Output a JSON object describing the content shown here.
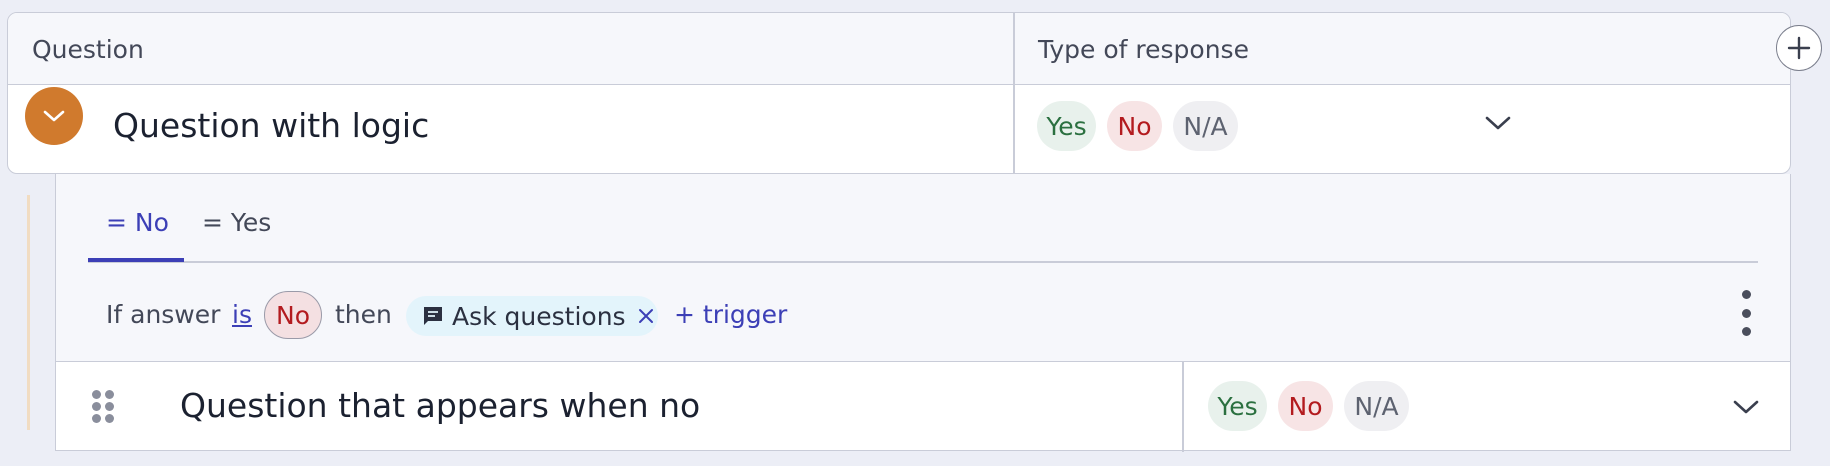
{
  "table": {
    "headers": {
      "question": "Question",
      "response": "Type of response"
    }
  },
  "main_question": {
    "title": "Question with logic",
    "responses": {
      "yes": "Yes",
      "no": "No",
      "na": "N/A"
    }
  },
  "logic": {
    "tabs": [
      {
        "label": "= No",
        "active": true
      },
      {
        "label": "= Yes",
        "active": false
      }
    ],
    "rule": {
      "prefix": "If answer",
      "operator": "is",
      "value": "No",
      "then": "then",
      "trigger_label": "Ask questions",
      "add_trigger": "+ trigger"
    }
  },
  "sub_question": {
    "title": "Question that appears when no",
    "responses": {
      "yes": "Yes",
      "no": "No",
      "na": "N/A"
    }
  },
  "icons": {
    "collapse": "chevron-down-icon",
    "add_column": "plus-icon",
    "trigger": "chat-icon",
    "remove": "close-icon",
    "menu": "more-vertical-icon",
    "drag": "drag-handle-icon"
  },
  "colors": {
    "accent": "#3c3fb6",
    "collapse_button": "#d07a2d",
    "yes_text": "#2b7040",
    "no_text": "#b31b1f"
  }
}
